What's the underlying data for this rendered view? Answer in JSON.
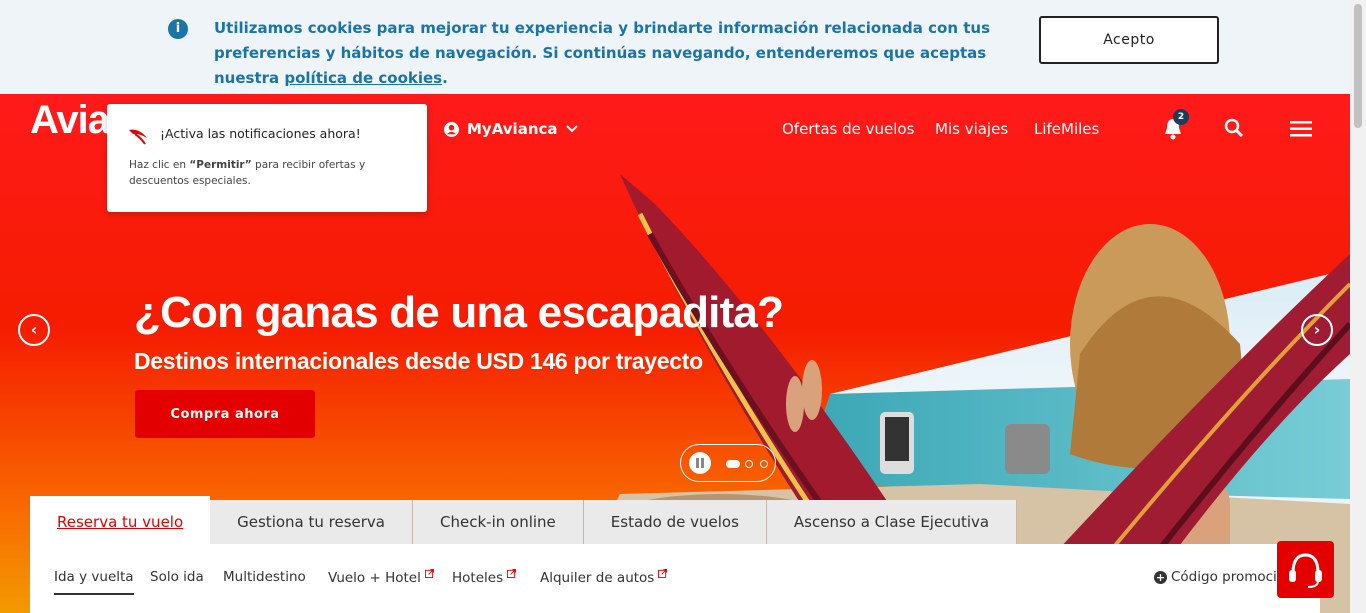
{
  "cookie_banner": {
    "text": "Utilizamos cookies para mejorar tu experiencia y brindarte información relacionada con tus preferencias y hábitos de navegación. Si continúas navegando, entenderemos que aceptas nuestra ",
    "link": "política de cookies",
    "end": ".",
    "accept_label": "Acepto"
  },
  "header": {
    "logo": "Avia",
    "myavianca": "MyAvianca",
    "links": [
      "Ofertas de vuelos",
      "Mis viajes",
      "LifeMiles"
    ],
    "notification_count": "2"
  },
  "notification_popup": {
    "title": "¡Activa las notificaciones ahora!",
    "body_prefix": "Haz clic en ",
    "body_bold": "“Permitir”",
    "body_suffix": " para recibir ofertas y descuentos especiales."
  },
  "hero": {
    "headline": "¿Con ganas de una escapadita?",
    "subheadline": "Destinos internacionales desde USD 146 por trayecto",
    "cta": "Compra ahora",
    "prev": "‹",
    "next": "›"
  },
  "booking": {
    "tabs": [
      "Reserva tu vuelo",
      "Gestiona tu reserva",
      "Check-in online",
      "Estado de vuelos",
      "Ascenso a Clase Ejecutiva"
    ],
    "subtabs": [
      "Ida y vuelta",
      "Solo ida",
      "Multidestino",
      "Vuelo + Hotel",
      "Hoteles",
      "Alquiler de autos"
    ],
    "promo": "Código promocio"
  },
  "colors": {
    "brand_red": "#e30000",
    "cookie_blue": "#1b74a8"
  }
}
